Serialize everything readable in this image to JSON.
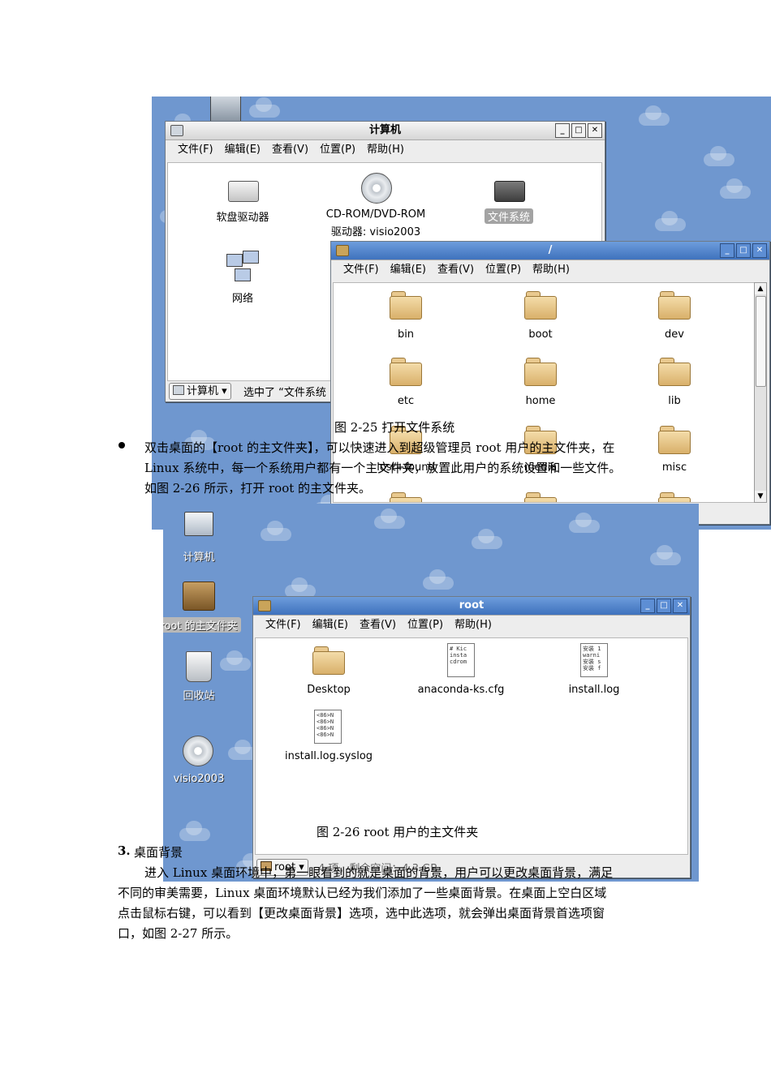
{
  "fig25": {
    "computer_window": {
      "title": "计算机",
      "menu": [
        "文件(F)",
        "编辑(E)",
        "查看(V)",
        "位置(P)",
        "帮助(H)"
      ],
      "icons": [
        {
          "label": "软盘驱动器"
        },
        {
          "label": "CD-ROM/DVD-ROM",
          "label2": "驱动器: visio2003"
        },
        {
          "label": "文件系统"
        },
        {
          "label": "网络"
        }
      ],
      "location_button": "计算机 ▾",
      "status_text": "选中了 “文件系统"
    },
    "root_fs_window": {
      "title": "/",
      "menu": [
        "文件(F)",
        "编辑(E)",
        "查看(V)",
        "位置(P)",
        "帮助(H)"
      ],
      "folders": [
        "bin",
        "boot",
        "dev",
        "etc",
        "home",
        "lib",
        "lost+found",
        "media",
        "misc"
      ]
    },
    "caption": "图 2-25  打开文件系统"
  },
  "bullet_paragraph": {
    "line1": "双击桌面的【root 的主文件夹】，可以快速进入到超级管理员 root 用户的主文件夹，在",
    "line2": "Linux 系统中，每一个系统用户都有一个主文件夹，放置此用户的系统设置和一些文件。",
    "line3": "如图 2-26 所示，打开 root 的主文件夹。"
  },
  "fig26": {
    "desktop_icons": [
      {
        "label": "计算机"
      },
      {
        "label": "root 的主文件夹"
      },
      {
        "label": "回收站"
      },
      {
        "label": "visio2003"
      }
    ],
    "root_window": {
      "title": "root",
      "menu": [
        "文件(F)",
        "编辑(E)",
        "查看(V)",
        "位置(P)",
        "帮助(H)"
      ],
      "files": [
        "Desktop",
        "anaconda-ks.cfg",
        "install.log",
        "install.log.syslog"
      ],
      "file_snippets": {
        "anaconda": [
          "# Kic",
          "",
          "insta",
          "cdrom"
        ],
        "install_log": [
          "安装 1",
          "warni",
          "安装 s",
          "安装 f"
        ],
        "syslog": [
          "<86>N",
          "<86>N",
          "<86>N",
          "<86>N"
        ]
      },
      "location_button": "root ▾",
      "status_text": "4 项，剩余空间：4.3 GB"
    },
    "caption": "图 2-26 root 用户的主文件夹"
  },
  "section": {
    "number": "3.",
    "title": "桌面背景",
    "para_line1": "进入 Linux 桌面环境中，第一眼看到的就是桌面的背景，用户可以更改桌面背景，满足",
    "para_line2": "不同的审美需要，Linux 桌面环境默认已经为我们添加了一些桌面背景。在桌面上空白区域",
    "para_line3": "点击鼠标右键，可以看到【更改桌面背景】选项，选中此选项，就会弹出桌面背景首选项窗",
    "para_line4": "口，如图 2-27 所示。"
  }
}
